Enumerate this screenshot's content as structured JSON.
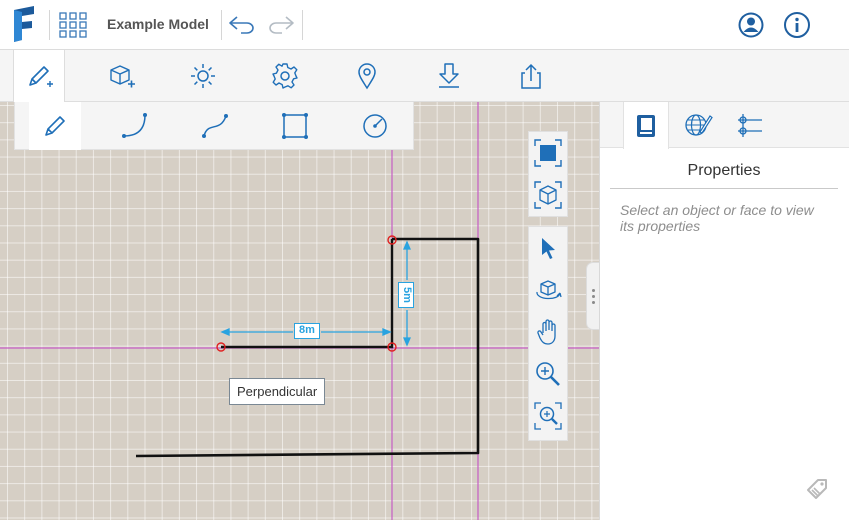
{
  "header": {
    "title": "Example Model",
    "logo_icon": "formit-logo-icon",
    "apps_icon": "app-grid-icon",
    "undo_icon": "undo-icon",
    "redo_icon": "redo-icon",
    "user_icon": "user-account-icon",
    "info_icon": "info-icon"
  },
  "toolbar": {
    "tabs": [
      {
        "icon": "sketch-pencil-icon",
        "active": true
      },
      {
        "icon": "add-object-icon",
        "active": false
      },
      {
        "icon": "sun-lighting-icon",
        "active": false
      },
      {
        "icon": "settings-gear-icon",
        "active": false
      },
      {
        "icon": "location-pin-icon",
        "active": false
      },
      {
        "icon": "import-download-icon",
        "active": false
      },
      {
        "icon": "export-share-icon",
        "active": false
      }
    ]
  },
  "draw_tools": [
    {
      "icon": "line-pencil-icon",
      "active": true
    },
    {
      "icon": "arc-icon",
      "active": false
    },
    {
      "icon": "spline-curve-icon",
      "active": false
    },
    {
      "icon": "rectangle-icon",
      "active": false
    },
    {
      "icon": "circle-icon",
      "active": false
    }
  ],
  "canvas": {
    "dimension_horizontal": "8m",
    "dimension_vertical": "5m",
    "snap_tooltip": "Perpendicular",
    "colors": {
      "ground": "#d6cfc5",
      "axis": "#c65ec5",
      "dimension": "#29a3e0",
      "snap_point": "#e02020",
      "sketch_line": "#111111"
    }
  },
  "view_controls": {
    "top_group": [
      "zoom-extents-icon",
      "perspective-cube-icon"
    ],
    "bottom_group": [
      "select-arrow-icon",
      "orbit-icon",
      "pan-hand-icon",
      "zoom-icon",
      "zoom-window-icon"
    ]
  },
  "properties_panel": {
    "tabs": [
      "properties-book-icon",
      "materials-globe-icon",
      "layers-icon"
    ],
    "title": "Properties",
    "hint": "Select an object or face to view its properties",
    "feedback_icon": "feedback-tag-icon"
  }
}
